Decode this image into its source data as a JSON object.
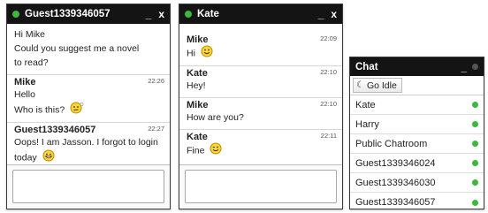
{
  "colors": {
    "online": "#3cb83c",
    "titlebar": "#141414",
    "border": "#3a3a3a"
  },
  "window_guest": {
    "title": "Guest1339346057",
    "minimize": "_",
    "close": "x",
    "messages": [
      {
        "sender": "",
        "time": "",
        "lines": [
          "Hi Mike",
          "Could you suggest me a novel",
          "to read?"
        ]
      },
      {
        "sender": "Mike",
        "time": "22:26",
        "lines": [
          "Hello",
          "Who is this?"
        ]
      },
      {
        "sender": "Guest1339346057",
        "time": "22:27",
        "lines": [
          "Oops! I am Jasson. I forgot to login",
          "today"
        ]
      }
    ]
  },
  "window_kate": {
    "title": "Kate",
    "minimize": "_",
    "close": "x",
    "messages": [
      {
        "sender": "Mike",
        "time": "22:09",
        "lines": [
          "Hi"
        ]
      },
      {
        "sender": "Kate",
        "time": "22:10",
        "lines": [
          "Hey!"
        ]
      },
      {
        "sender": "Mike",
        "time": "22:10",
        "lines": [
          "How are you?"
        ]
      },
      {
        "sender": "Kate",
        "time": "22:11",
        "lines": [
          "Fine"
        ]
      }
    ]
  },
  "chat_list": {
    "title": "Chat",
    "minimize": "_",
    "go_idle": "Go Idle",
    "contacts": [
      "Kate",
      "Harry",
      "Public Chatroom",
      "Guest1339346024",
      "Guest1339346030",
      "Guest1339346057"
    ]
  }
}
